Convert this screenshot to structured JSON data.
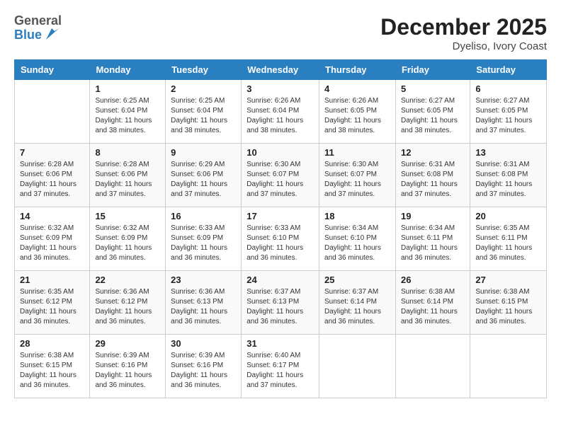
{
  "logo": {
    "general": "General",
    "blue": "Blue"
  },
  "title": "December 2025",
  "location": "Dyeliso, Ivory Coast",
  "days_of_week": [
    "Sunday",
    "Monday",
    "Tuesday",
    "Wednesday",
    "Thursday",
    "Friday",
    "Saturday"
  ],
  "weeks": [
    [
      {
        "day": "",
        "info": ""
      },
      {
        "day": "1",
        "info": "Sunrise: 6:25 AM\nSunset: 6:04 PM\nDaylight: 11 hours and 38 minutes."
      },
      {
        "day": "2",
        "info": "Sunrise: 6:25 AM\nSunset: 6:04 PM\nDaylight: 11 hours and 38 minutes."
      },
      {
        "day": "3",
        "info": "Sunrise: 6:26 AM\nSunset: 6:04 PM\nDaylight: 11 hours and 38 minutes."
      },
      {
        "day": "4",
        "info": "Sunrise: 6:26 AM\nSunset: 6:05 PM\nDaylight: 11 hours and 38 minutes."
      },
      {
        "day": "5",
        "info": "Sunrise: 6:27 AM\nSunset: 6:05 PM\nDaylight: 11 hours and 38 minutes."
      },
      {
        "day": "6",
        "info": "Sunrise: 6:27 AM\nSunset: 6:05 PM\nDaylight: 11 hours and 37 minutes."
      }
    ],
    [
      {
        "day": "7",
        "info": "Sunrise: 6:28 AM\nSunset: 6:06 PM\nDaylight: 11 hours and 37 minutes."
      },
      {
        "day": "8",
        "info": "Sunrise: 6:28 AM\nSunset: 6:06 PM\nDaylight: 11 hours and 37 minutes."
      },
      {
        "day": "9",
        "info": "Sunrise: 6:29 AM\nSunset: 6:06 PM\nDaylight: 11 hours and 37 minutes."
      },
      {
        "day": "10",
        "info": "Sunrise: 6:30 AM\nSunset: 6:07 PM\nDaylight: 11 hours and 37 minutes."
      },
      {
        "day": "11",
        "info": "Sunrise: 6:30 AM\nSunset: 6:07 PM\nDaylight: 11 hours and 37 minutes."
      },
      {
        "day": "12",
        "info": "Sunrise: 6:31 AM\nSunset: 6:08 PM\nDaylight: 11 hours and 37 minutes."
      },
      {
        "day": "13",
        "info": "Sunrise: 6:31 AM\nSunset: 6:08 PM\nDaylight: 11 hours and 37 minutes."
      }
    ],
    [
      {
        "day": "14",
        "info": "Sunrise: 6:32 AM\nSunset: 6:09 PM\nDaylight: 11 hours and 36 minutes."
      },
      {
        "day": "15",
        "info": "Sunrise: 6:32 AM\nSunset: 6:09 PM\nDaylight: 11 hours and 36 minutes."
      },
      {
        "day": "16",
        "info": "Sunrise: 6:33 AM\nSunset: 6:09 PM\nDaylight: 11 hours and 36 minutes."
      },
      {
        "day": "17",
        "info": "Sunrise: 6:33 AM\nSunset: 6:10 PM\nDaylight: 11 hours and 36 minutes."
      },
      {
        "day": "18",
        "info": "Sunrise: 6:34 AM\nSunset: 6:10 PM\nDaylight: 11 hours and 36 minutes."
      },
      {
        "day": "19",
        "info": "Sunrise: 6:34 AM\nSunset: 6:11 PM\nDaylight: 11 hours and 36 minutes."
      },
      {
        "day": "20",
        "info": "Sunrise: 6:35 AM\nSunset: 6:11 PM\nDaylight: 11 hours and 36 minutes."
      }
    ],
    [
      {
        "day": "21",
        "info": "Sunrise: 6:35 AM\nSunset: 6:12 PM\nDaylight: 11 hours and 36 minutes."
      },
      {
        "day": "22",
        "info": "Sunrise: 6:36 AM\nSunset: 6:12 PM\nDaylight: 11 hours and 36 minutes."
      },
      {
        "day": "23",
        "info": "Sunrise: 6:36 AM\nSunset: 6:13 PM\nDaylight: 11 hours and 36 minutes."
      },
      {
        "day": "24",
        "info": "Sunrise: 6:37 AM\nSunset: 6:13 PM\nDaylight: 11 hours and 36 minutes."
      },
      {
        "day": "25",
        "info": "Sunrise: 6:37 AM\nSunset: 6:14 PM\nDaylight: 11 hours and 36 minutes."
      },
      {
        "day": "26",
        "info": "Sunrise: 6:38 AM\nSunset: 6:14 PM\nDaylight: 11 hours and 36 minutes."
      },
      {
        "day": "27",
        "info": "Sunrise: 6:38 AM\nSunset: 6:15 PM\nDaylight: 11 hours and 36 minutes."
      }
    ],
    [
      {
        "day": "28",
        "info": "Sunrise: 6:38 AM\nSunset: 6:15 PM\nDaylight: 11 hours and 36 minutes."
      },
      {
        "day": "29",
        "info": "Sunrise: 6:39 AM\nSunset: 6:16 PM\nDaylight: 11 hours and 36 minutes."
      },
      {
        "day": "30",
        "info": "Sunrise: 6:39 AM\nSunset: 6:16 PM\nDaylight: 11 hours and 36 minutes."
      },
      {
        "day": "31",
        "info": "Sunrise: 6:40 AM\nSunset: 6:17 PM\nDaylight: 11 hours and 37 minutes."
      },
      {
        "day": "",
        "info": ""
      },
      {
        "day": "",
        "info": ""
      },
      {
        "day": "",
        "info": ""
      }
    ]
  ]
}
